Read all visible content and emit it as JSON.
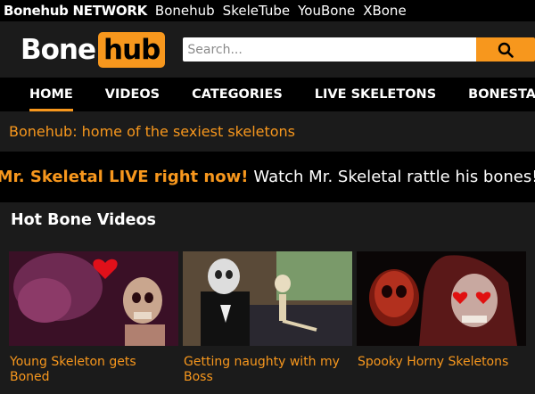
{
  "network": {
    "brand": "Bonehub NETWORK",
    "links": [
      "Bonehub",
      "SkeleTube",
      "YouBone",
      "XBone"
    ]
  },
  "header": {
    "logo_left": "Bone",
    "logo_right": "hub",
    "search_placeholder": "Search..."
  },
  "nav": {
    "items": [
      "HOME",
      "VIDEOS",
      "CATEGORIES",
      "LIVE SKELETONS",
      "BONESTARS"
    ],
    "active": "HOME"
  },
  "tagline": "Bonehub: home of the sexiest skeletons",
  "live_banner": {
    "link_text": "Mr. Skeletal LIVE right now!",
    "text": "Watch Mr. Skeletal rattle his bones!"
  },
  "section": {
    "title": "Hot Bone Videos"
  },
  "videos": [
    {
      "title": "Young Skeleton gets Boned"
    },
    {
      "title": "Getting naughty with my Boss"
    },
    {
      "title": "Spooky Horny Skeletons"
    }
  ],
  "colors": {
    "accent": "#f7971d",
    "panel": "#1b1b1b",
    "background": "#000000"
  }
}
